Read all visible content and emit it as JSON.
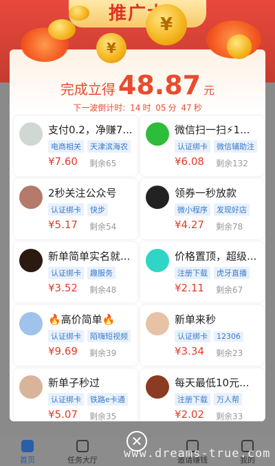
{
  "page": {
    "banner_title": "推广大"
  },
  "modal": {
    "headline_prefix": "完成立得",
    "headline_amount": "48.87",
    "headline_unit": "元",
    "countdown_label": "下一波倒计时:",
    "countdown_h": "14",
    "countdown_h_unit": "时",
    "countdown_m": "05",
    "countdown_m_unit": "分",
    "countdown_s": "47",
    "countdown_s_unit": "秒"
  },
  "tasks": [
    {
      "title": "支付0.2，净赚7...",
      "tags": [
        "电商相关",
        "天津滨海农"
      ],
      "price": "¥7.60",
      "remain": "剩余65",
      "avatar_color": "#cfd8d2"
    },
    {
      "title": "微信扫一扫⚡1...",
      "tags": [
        "认证绑卡",
        "微信辅助注"
      ],
      "price": "¥6.08",
      "remain": "剩余132",
      "avatar_color": "#2dbd3a"
    },
    {
      "title": "2秒关注公众号",
      "tags": [
        "认证绑卡",
        "快步"
      ],
      "price": "¥5.17",
      "remain": "剩余54",
      "avatar_color": "#b47a6a"
    },
    {
      "title": "领券一秒放款",
      "tags": [
        "微小程序",
        "发现好店"
      ],
      "price": "¥4.27",
      "remain": "剩余78",
      "avatar_color": "#222222"
    },
    {
      "title": "新单简单实名就...",
      "tags": [
        "认证绑卡",
        "趣服务"
      ],
      "price": "¥3.52",
      "remain": "剩余48",
      "avatar_color": "#2a1a10"
    },
    {
      "title": "价格置顶，超级...",
      "tags": [
        "注册下载",
        "虎牙直播"
      ],
      "price": "¥2.11",
      "remain": "剩余67",
      "avatar_color": "#2fd6c6"
    },
    {
      "title": "🔥高价简单🔥",
      "tags": [
        "认证绑卡",
        "陌嗨短视频"
      ],
      "price": "¥9.69",
      "remain": "剩余39",
      "avatar_color": "#9fc3ea"
    },
    {
      "title": "新单来秒",
      "tags": [
        "认证绑卡",
        "12306"
      ],
      "price": "¥3.34",
      "remain": "剩余23",
      "avatar_color": "#e8c2a6"
    },
    {
      "title": "新单子秒过",
      "tags": [
        "认证绑卡",
        "铁路e卡通"
      ],
      "price": "¥5.07",
      "remain": "剩余35",
      "avatar_color": "#d8b49a"
    },
    {
      "title": "每天最低10元...",
      "tags": [
        "注册下载",
        "万人帮"
      ],
      "price": "¥2.02",
      "remain": "剩余33",
      "avatar_color": "#8a3b22"
    }
  ],
  "tabbar": {
    "tab1": "首页",
    "tab2": "任务大厅",
    "tab4": "邀请赚钱",
    "tab5": "我的"
  },
  "watermark": "www.dreams-true.com",
  "close_glyph": "✕",
  "colors": {
    "accent": "#e84b2f",
    "tag_text": "#3c7ac9",
    "price": "#e23b2a"
  }
}
